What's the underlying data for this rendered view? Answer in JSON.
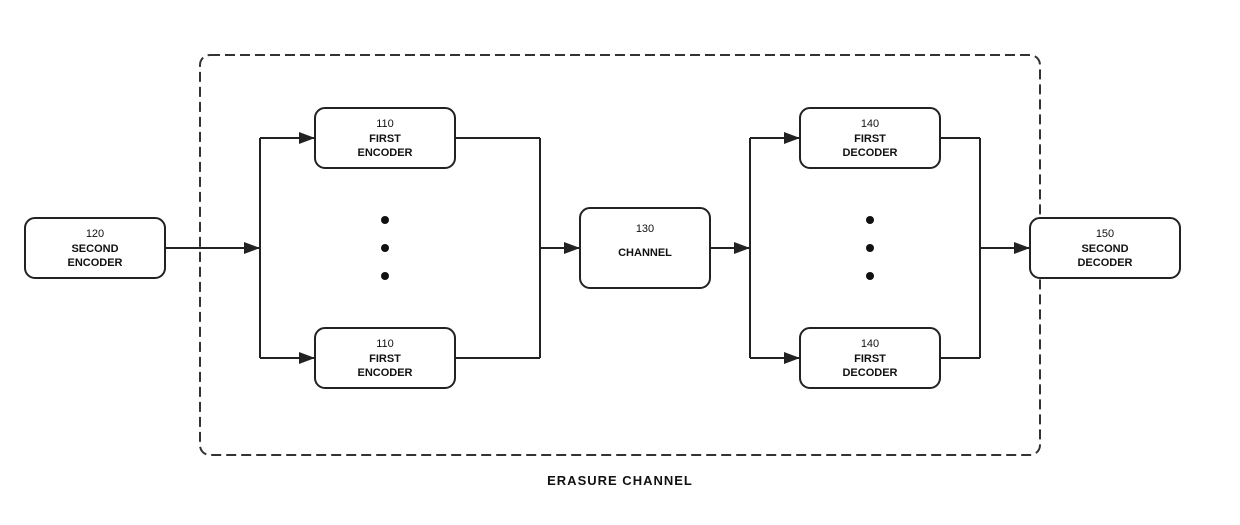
{
  "diagram": {
    "title": "ERASURE CHANNEL",
    "boxes": [
      {
        "id": "second-encoder",
        "num": "120",
        "line1": "SECOND",
        "line2": "ENCODER"
      },
      {
        "id": "first-encoder-top",
        "num": "110",
        "line1": "FIRST",
        "line2": "ENCODER"
      },
      {
        "id": "first-encoder-bottom",
        "num": "110",
        "line1": "FIRST",
        "line2": "ENCODER"
      },
      {
        "id": "channel",
        "num": "130",
        "line1": "CHANNEL",
        "line2": ""
      },
      {
        "id": "first-decoder-top",
        "num": "140",
        "line1": "FIRST",
        "line2": "DECODER"
      },
      {
        "id": "first-decoder-bottom",
        "num": "140",
        "line1": "FIRST",
        "line2": "DECODER"
      },
      {
        "id": "second-decoder",
        "num": "150",
        "line1": "SECOND",
        "line2": "DECODER"
      }
    ],
    "colors": {
      "background": "#ffffff",
      "box_fill": "#ffffff",
      "box_stroke": "#222222",
      "dashed_stroke": "#333333",
      "arrow_color": "#222222",
      "text_color": "#111111"
    }
  }
}
